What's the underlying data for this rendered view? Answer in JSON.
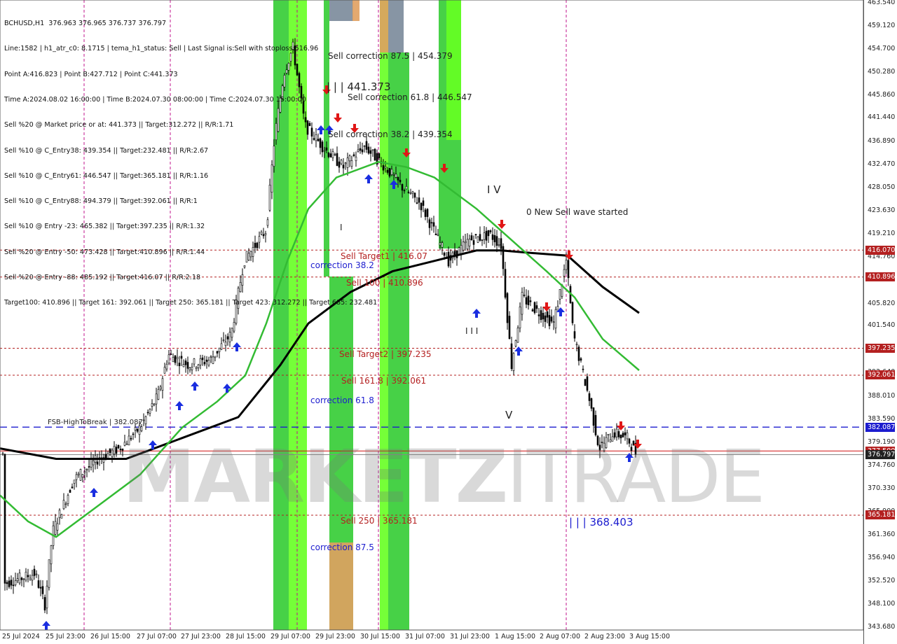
{
  "header_lines": [
    "BCHUSD,H1  376.963 376.965 376.737 376.797",
    "Line:1582 | h1_atr_c0: 8.1715 | tema_h1_status: Sell | Last Signal is:Sell with stoploss:516.96",
    "Point A:416.823 | Point B:427.712 | Point C:441.373",
    "Time A:2024.08.02 16:00:00 | Time B:2024.07.30 08:00:00 | Time C:2024.07.30 15:00:00",
    "Sell %20 @ Market price or at: 441.373 || Target:312.272 || R/R:1.71",
    "Sell %10 @ C_Entry38: 439.354 || Target:232.481 || R/R:2.67",
    "Sell %10 @ C_Entry61: 446.547 || Target:365.181 || R/R:1.16",
    "Sell %10 @ C_Entry88: 494.379 || Target:392.061 || R/R:1",
    "Sell %10 @ Entry -23: 465.382 || Target:397.235 || R/R:1.32",
    "Sell %20 @ Entry -50: 473.428 || Target:410.896 || R/R:1.44",
    "Sell %20 @ Entry -88: 485.192 || Target:416.07 || R/R:2.18",
    "Target100: 410.896 || Target 161: 392.061 || Target 250: 365.181 || Target 423: 312.272 || Target 685: 232.481"
  ],
  "chart_labels": {
    "sell_corr_875": "Sell correction 87.5 | 454.379",
    "sell_corr_618": "Sell correction 61.8 | 446.547",
    "sell_corr_382": "Sell correction 38.2 | 439.354",
    "point_c": "| | | 441.373",
    "wave_iv": "I V",
    "wave_v": "V",
    "wave_iii": "I I I",
    "wave_i": "I",
    "new_wave": "0 New Sell wave started",
    "sell_target1": "Sell Target1 | 416.07",
    "sell_100": "Sell 100 | 410.896",
    "sell_target2": "Sell Target2 | 397.235",
    "sell_1618": "Sell 161.8 | 392.061",
    "sell_250": "Sell  250 | 365.181",
    "correction_382": "correction 38.2",
    "correction_618": "correction 61.8",
    "correction_875": "correction 87.5",
    "fsb": "FSB-HighToBreak | 382.087",
    "low_mark": "| | | 368.403",
    "watermark_bold": "MARKETZ",
    "watermark_thin": "ITRADE"
  },
  "price_axis": {
    "ticks": [
      "463.540",
      "459.120",
      "454.700",
      "450.280",
      "445.860",
      "441.440",
      "436.890",
      "432.470",
      "428.050",
      "423.630",
      "419.210",
      "414.760",
      "410.340",
      "405.820",
      "401.540",
      "397.060",
      "392.640",
      "388.010",
      "383.590",
      "379.190",
      "374.760",
      "370.330",
      "365.900",
      "361.360",
      "356.940",
      "352.520",
      "348.100",
      "343.680"
    ],
    "badges": [
      {
        "text": "416.070",
        "color": "#b42020"
      },
      {
        "text": "410.896",
        "color": "#b42020"
      },
      {
        "text": "397.235",
        "color": "#b42020"
      },
      {
        "text": "392.061",
        "color": "#b42020"
      },
      {
        "text": "382.087",
        "color": "#1c1ccf"
      },
      {
        "text": "377.500",
        "color": "#b42020"
      },
      {
        "text": "376.797",
        "color": "#222222"
      },
      {
        "text": "365.181",
        "color": "#b42020"
      }
    ]
  },
  "time_axis": [
    "25 Jul 2024",
    "25 Jul 23:00",
    "26 Jul 15:00",
    "27 Jul 07:00",
    "27 Jul 23:00",
    "28 Jul 15:00",
    "29 Jul 07:00",
    "29 Jul 23:00",
    "30 Jul 15:00",
    "31 Jul 07:00",
    "31 Jul 23:00",
    "1 Aug 15:00",
    "2 Aug 07:00",
    "2 Aug 23:00",
    "3 Aug 15:00"
  ],
  "levels": {
    "target1": 416.07,
    "sell100": 410.896,
    "target2": 397.235,
    "sell1618": 392.061,
    "fsb": 382.087,
    "stop_red": 377.5,
    "current": 376.797,
    "sell250": 365.181
  },
  "colors": {
    "zone_green": "#33cc33",
    "zone_lime": "#66ff22",
    "zone_orange": "#e0a060",
    "zone_gray": "#7a8a9a",
    "level_red": "#b42020",
    "fsb_blue": "#1c1ccf",
    "ma_fast": "#33bb33",
    "ma_slow": "#000000",
    "envelope": "#ff5511"
  }
}
